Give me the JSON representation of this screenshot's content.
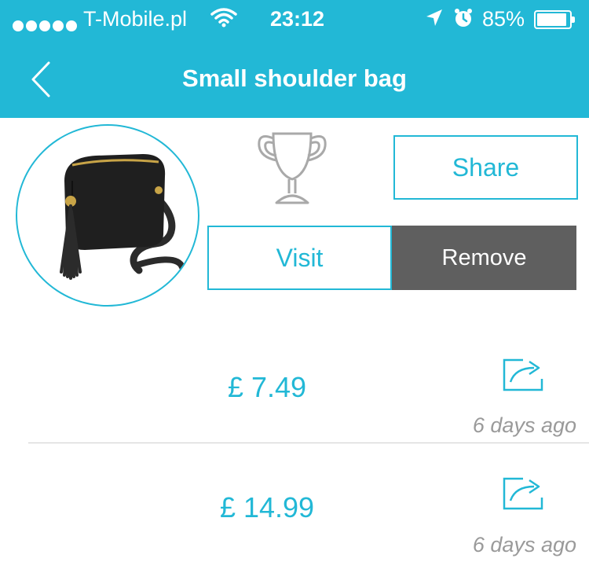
{
  "status_bar": {
    "carrier": "T-Mobile.pl",
    "time": "23:12",
    "battery": "85%",
    "battery_level": 0.85,
    "icons": [
      "signal-dots-icon",
      "wifi-icon",
      "location-arrow-icon",
      "alarm-icon",
      "battery-icon"
    ]
  },
  "header": {
    "title": "Small shoulder bag",
    "back_icon": "chevron-left-icon"
  },
  "product": {
    "image": "small-shoulder-bag-image",
    "award_icon": "trophy-icon",
    "share_label": "Share",
    "visit_label": "Visit",
    "remove_label": "Remove"
  },
  "prices": [
    {
      "price": "£ 7.49",
      "ago": "6 days ago",
      "icon": "share-arrow-icon"
    },
    {
      "price": "£ 14.99",
      "ago": "6 days ago",
      "icon": "share-arrow-icon"
    }
  ],
  "colors": {
    "accent": "#22b8d6",
    "remove_bg": "#5f5f5f",
    "muted_text": "#9a9a9a"
  }
}
